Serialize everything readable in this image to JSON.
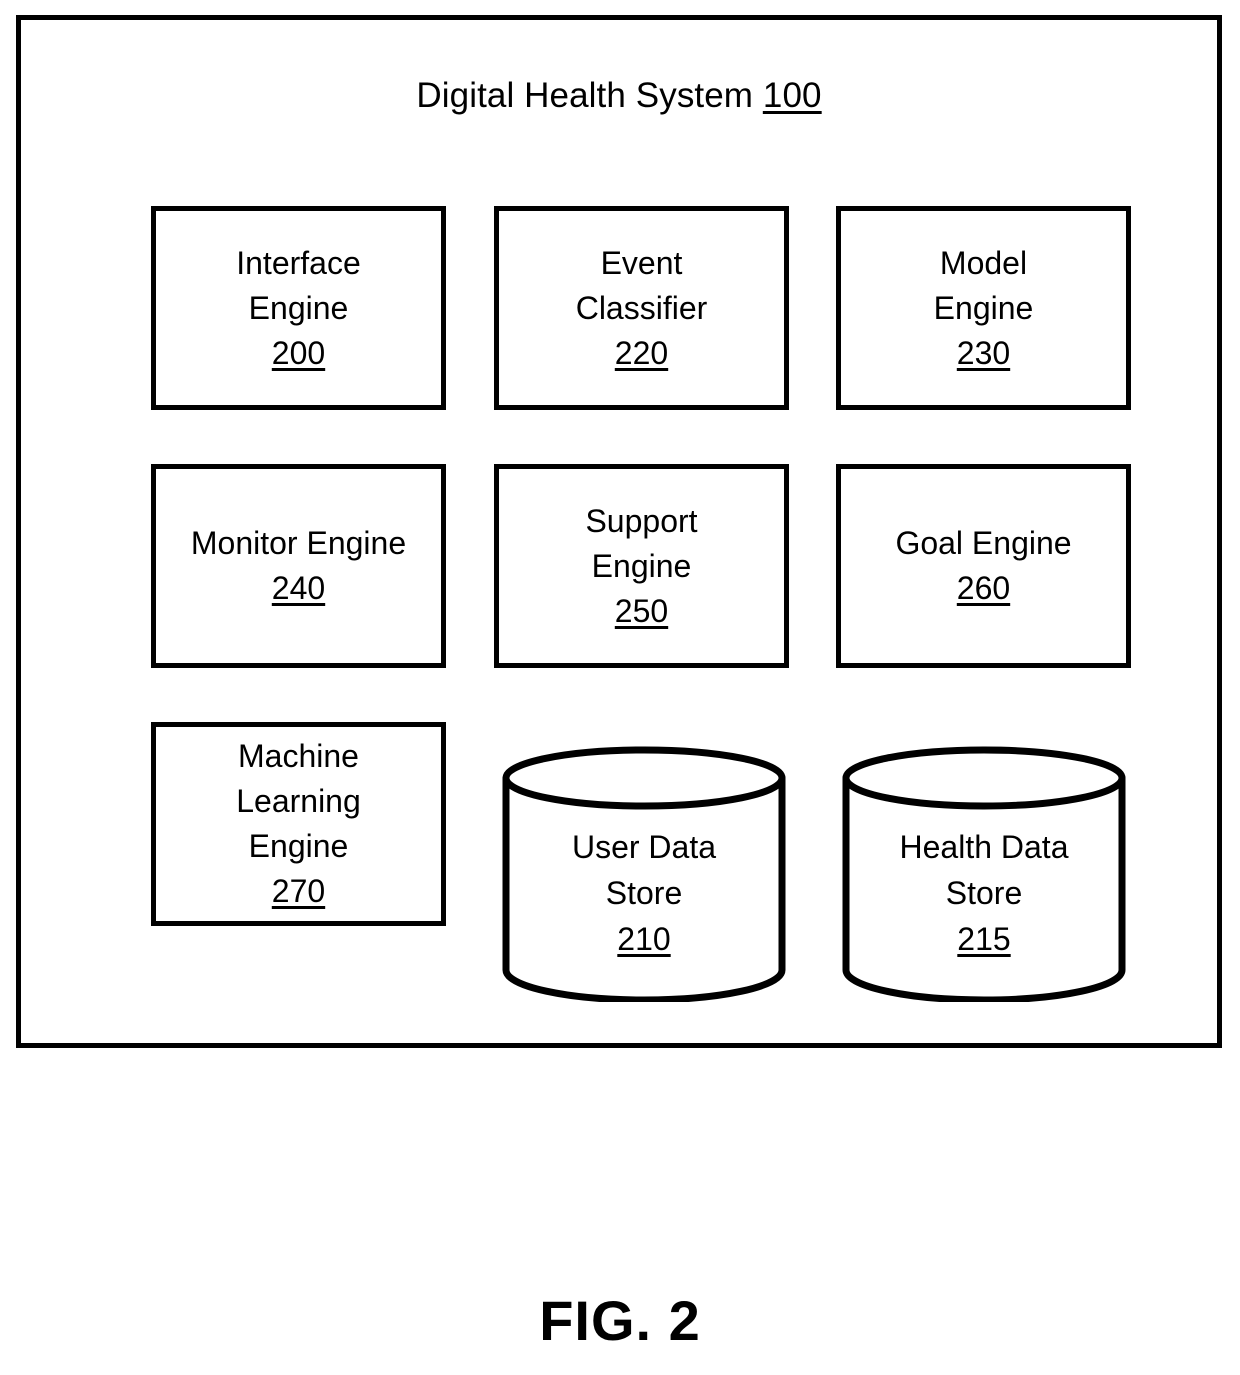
{
  "figure": {
    "caption": "FIG. 2"
  },
  "system": {
    "title_text": "Digital Health System",
    "title_ref": "100"
  },
  "components": [
    {
      "id": "interface",
      "name": "Interface\nEngine",
      "ref": "200",
      "shape": "box"
    },
    {
      "id": "event",
      "name": "Event\nClassifier",
      "ref": "220",
      "shape": "box"
    },
    {
      "id": "model",
      "name": "Model\nEngine",
      "ref": "230",
      "shape": "box"
    },
    {
      "id": "monitor",
      "name": "Monitor Engine",
      "ref": "240",
      "shape": "box"
    },
    {
      "id": "support",
      "name": "Support\nEngine",
      "ref": "250",
      "shape": "box"
    },
    {
      "id": "goal",
      "name": "Goal Engine",
      "ref": "260",
      "shape": "box"
    },
    {
      "id": "ml",
      "name": "Machine\nLearning\nEngine",
      "ref": "270",
      "shape": "box"
    },
    {
      "id": "user_store",
      "name": "User Data\nStore",
      "ref": "210",
      "shape": "cylinder"
    },
    {
      "id": "health_store",
      "name": "Health Data\nStore",
      "ref": "215",
      "shape": "cylinder"
    }
  ],
  "style": {
    "line_color": "#000000",
    "background_color": "#ffffff"
  }
}
